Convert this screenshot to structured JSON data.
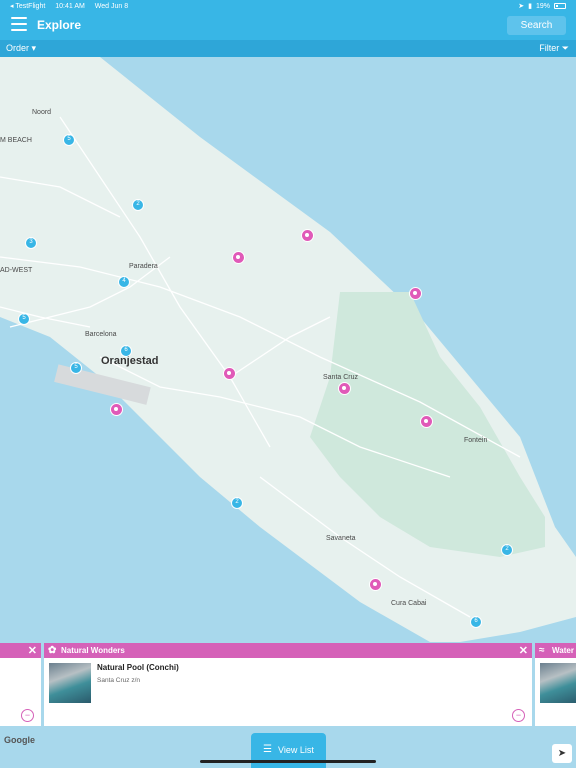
{
  "status": {
    "carrier": "◂ TestFlight",
    "time": "10:41 AM",
    "date": "Wed Jun 8",
    "battery": "19%"
  },
  "header": {
    "title": "Explore",
    "search_label": "Search"
  },
  "toolbar": {
    "order_label": "Order ▾",
    "filter_label": "Filter ⏷"
  },
  "map": {
    "places": [
      "Noord",
      "M BEACH",
      "Paradera",
      "AD-WEST",
      "Barcelona",
      "Oranjestad",
      "Santa Cruz",
      "Fontein",
      "Savaneta",
      "Cura Cabai"
    ],
    "clusters": [
      "5",
      "2",
      "3",
      "4",
      "5",
      "6",
      "5",
      "2",
      "2",
      "6"
    ],
    "google_label": "Google"
  },
  "cards": [
    {
      "category": "Natural Wonders",
      "title": "Natural Pool (Conchi)",
      "address": "Santa Cruz z/n",
      "close": "✕",
      "remove": "−"
    },
    {
      "category": "Water"
    }
  ],
  "view_list_label": "View List",
  "colors": {
    "primary": "#38b6e6",
    "accent": "#d561b8",
    "sea": "#a8d8ec",
    "land": "#e7f1ee",
    "park": "#cfe8dc"
  }
}
